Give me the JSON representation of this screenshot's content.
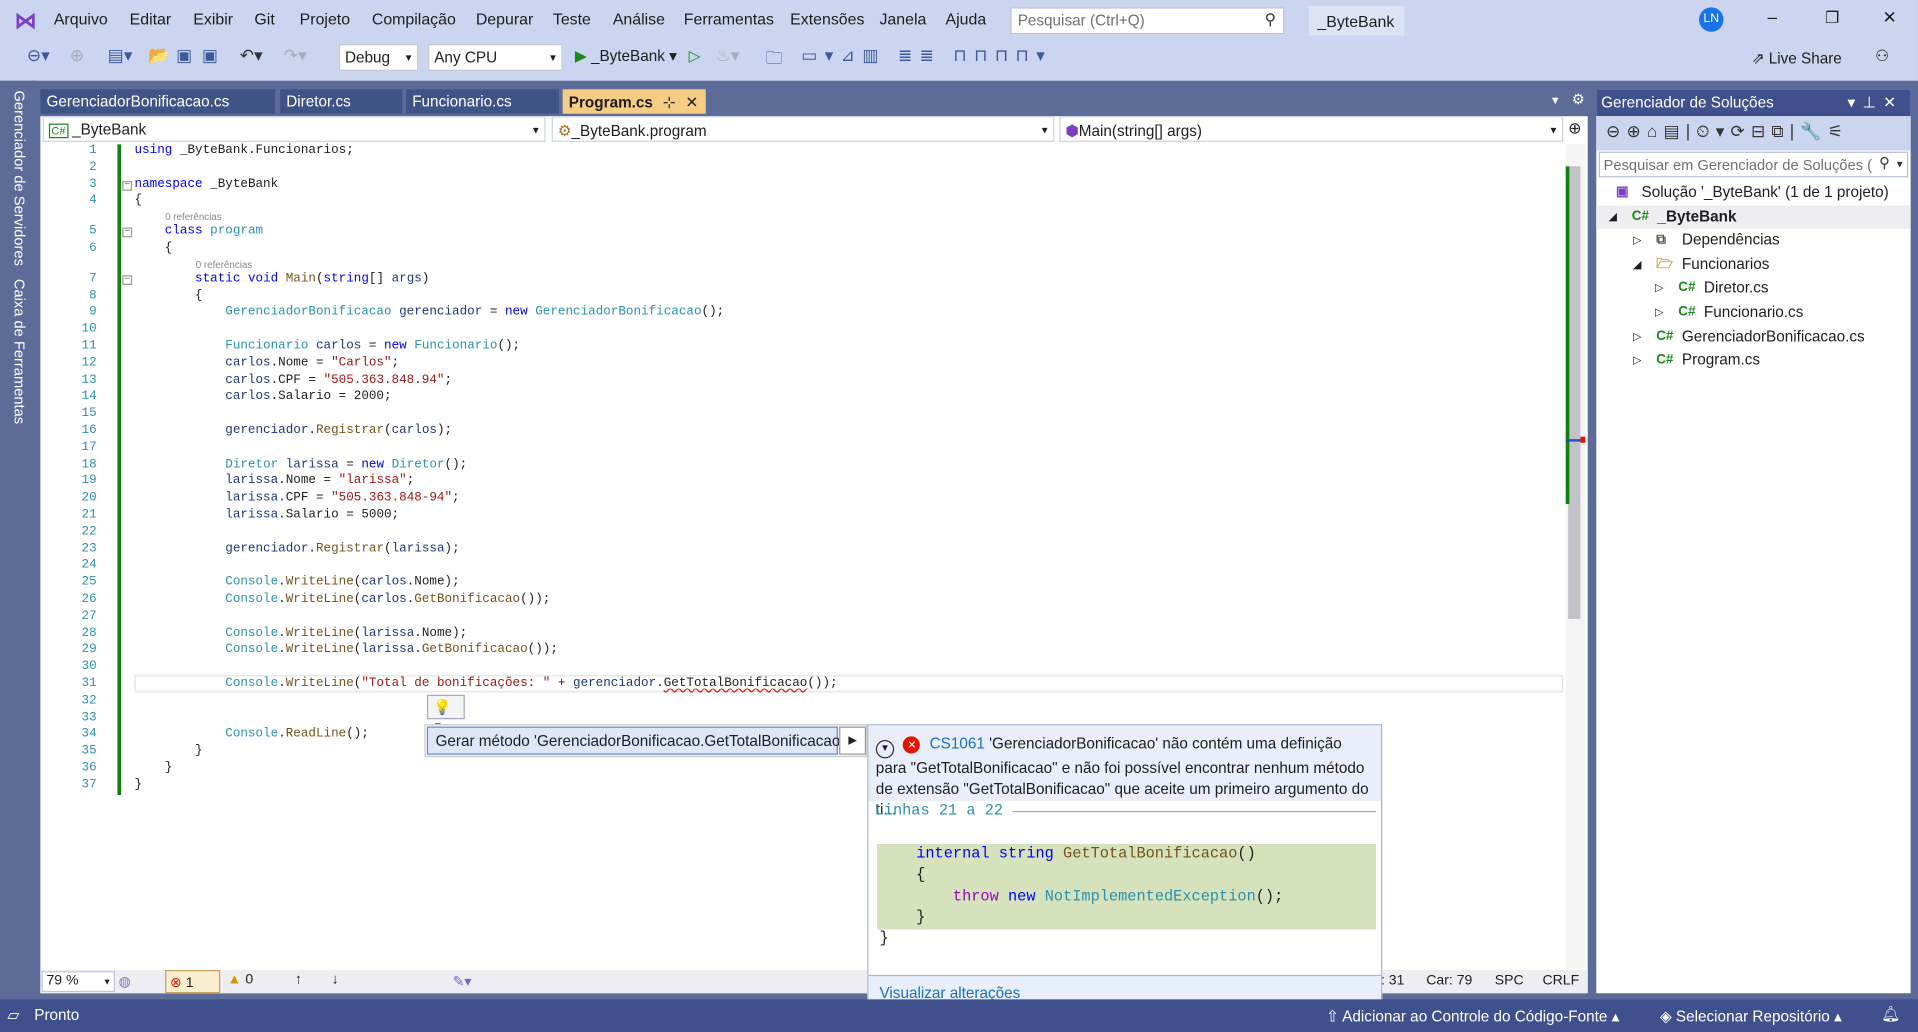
{
  "menu": [
    "Arquivo",
    "Editar",
    "Exibir",
    "Git",
    "Projeto",
    "Compilação",
    "Depurar",
    "Teste",
    "Análise",
    "Ferramentas",
    "Extensões",
    "Janela",
    "Ajuda"
  ],
  "search_placeholder": "Pesquisar (Ctrl+Q)",
  "project_name": "_ByteBank",
  "avatar": "LN",
  "toolbar": {
    "config": "Debug",
    "platform": "Any CPU",
    "run": "_ByteBank",
    "live_share": "Live Share"
  },
  "left_strip": [
    "Gerenciador de Servidores",
    "Caixa de Ferramentas"
  ],
  "tabs": [
    {
      "label": "GerenciadorBonificacao.cs"
    },
    {
      "label": "Diretor.cs"
    },
    {
      "label": "Funcionario.cs"
    },
    {
      "label": "Program.cs",
      "active": true
    }
  ],
  "nav": {
    "project": "_ByteBank",
    "class": "_ByteBank.program",
    "member": "Main(string[] args)"
  },
  "codelens": "0 referências",
  "code": [
    [
      1,
      [
        [
          "using",
          "kw"
        ],
        [
          " _ByteBank.Funcionarios;",
          ""
        ]
      ]
    ],
    [
      2,
      []
    ],
    [
      3,
      [
        [
          "namespace",
          "kw"
        ],
        [
          " _ByteBank",
          ""
        ]
      ]
    ],
    [
      4,
      [
        [
          "{",
          ""
        ]
      ]
    ],
    [
      5,
      [
        [
          "    ",
          ""
        ],
        [
          "class",
          "kw"
        ],
        [
          " ",
          ""
        ],
        [
          "program",
          "ty"
        ]
      ],
      "lens"
    ],
    [
      6,
      [
        [
          "    {",
          ""
        ]
      ]
    ],
    [
      7,
      [
        [
          "        ",
          ""
        ],
        [
          "static",
          "kw"
        ],
        [
          " ",
          ""
        ],
        [
          "void",
          "kw"
        ],
        [
          " ",
          ""
        ],
        [
          "Main",
          "me"
        ],
        [
          "(",
          ""
        ],
        [
          "string",
          "kw"
        ],
        [
          "[] ",
          ""
        ],
        [
          "args",
          "va"
        ],
        [
          ")",
          ""
        ]
      ],
      "lens"
    ],
    [
      8,
      [
        [
          "        {",
          ""
        ]
      ]
    ],
    [
      9,
      [
        [
          "            ",
          ""
        ],
        [
          "GerenciadorBonificacao",
          "ty"
        ],
        [
          " ",
          ""
        ],
        [
          "gerenciador",
          "va"
        ],
        [
          " = ",
          ""
        ],
        [
          "new",
          "kw"
        ],
        [
          " ",
          ""
        ],
        [
          "GerenciadorBonificacao",
          "ty"
        ],
        [
          "();",
          ""
        ]
      ]
    ],
    [
      10,
      []
    ],
    [
      11,
      [
        [
          "            ",
          ""
        ],
        [
          "Funcionario",
          "ty"
        ],
        [
          " ",
          ""
        ],
        [
          "carlos",
          "va"
        ],
        [
          " = ",
          ""
        ],
        [
          "new",
          "kw"
        ],
        [
          " ",
          ""
        ],
        [
          "Funcionario",
          "ty"
        ],
        [
          "();",
          ""
        ]
      ]
    ],
    [
      12,
      [
        [
          "            ",
          ""
        ],
        [
          "carlos",
          "va"
        ],
        [
          ".Nome = ",
          ""
        ],
        [
          "\"Carlos\"",
          "st"
        ],
        [
          ";",
          ""
        ]
      ]
    ],
    [
      13,
      [
        [
          "            ",
          ""
        ],
        [
          "carlos",
          "va"
        ],
        [
          ".CPF = ",
          ""
        ],
        [
          "\"505.363.848.94\"",
          "st"
        ],
        [
          ";",
          ""
        ]
      ]
    ],
    [
      14,
      [
        [
          "            ",
          ""
        ],
        [
          "carlos",
          "va"
        ],
        [
          ".Salario = 2000;",
          ""
        ]
      ]
    ],
    [
      15,
      []
    ],
    [
      16,
      [
        [
          "            ",
          ""
        ],
        [
          "gerenciador",
          "va"
        ],
        [
          ".",
          ""
        ],
        [
          "Registrar",
          "me"
        ],
        [
          "(",
          ""
        ],
        [
          "carlos",
          "va"
        ],
        [
          ");",
          ""
        ]
      ]
    ],
    [
      17,
      []
    ],
    [
      18,
      [
        [
          "            ",
          ""
        ],
        [
          "Diretor",
          "ty"
        ],
        [
          " ",
          ""
        ],
        [
          "larissa",
          "va"
        ],
        [
          " = ",
          ""
        ],
        [
          "new",
          "kw"
        ],
        [
          " ",
          ""
        ],
        [
          "Diretor",
          "ty"
        ],
        [
          "();",
          ""
        ]
      ]
    ],
    [
      19,
      [
        [
          "            ",
          ""
        ],
        [
          "larissa",
          "va"
        ],
        [
          ".Nome = ",
          ""
        ],
        [
          "\"larissa\"",
          "st"
        ],
        [
          ";",
          ""
        ]
      ]
    ],
    [
      20,
      [
        [
          "            ",
          ""
        ],
        [
          "larissa",
          "va"
        ],
        [
          ".CPF = ",
          ""
        ],
        [
          "\"505.363.848-94\"",
          "st"
        ],
        [
          ";",
          ""
        ]
      ]
    ],
    [
      21,
      [
        [
          "            ",
          ""
        ],
        [
          "larissa",
          "va"
        ],
        [
          ".Salario = 5000;",
          ""
        ]
      ]
    ],
    [
      22,
      []
    ],
    [
      23,
      [
        [
          "            ",
          ""
        ],
        [
          "gerenciador",
          "va"
        ],
        [
          ".",
          ""
        ],
        [
          "Registrar",
          "me"
        ],
        [
          "(",
          ""
        ],
        [
          "larissa",
          "va"
        ],
        [
          ");",
          ""
        ]
      ]
    ],
    [
      24,
      []
    ],
    [
      25,
      [
        [
          "            ",
          ""
        ],
        [
          "Console",
          "ty"
        ],
        [
          ".",
          ""
        ],
        [
          "WriteLine",
          "me"
        ],
        [
          "(",
          ""
        ],
        [
          "carlos",
          "va"
        ],
        [
          ".Nome);",
          ""
        ]
      ]
    ],
    [
      26,
      [
        [
          "            ",
          ""
        ],
        [
          "Console",
          "ty"
        ],
        [
          ".",
          ""
        ],
        [
          "WriteLine",
          "me"
        ],
        [
          "(",
          ""
        ],
        [
          "carlos",
          "va"
        ],
        [
          ".",
          ""
        ],
        [
          "GetBonificacao",
          "me"
        ],
        [
          "());",
          ""
        ]
      ]
    ],
    [
      27,
      []
    ],
    [
      28,
      [
        [
          "            ",
          ""
        ],
        [
          "Console",
          "ty"
        ],
        [
          ".",
          ""
        ],
        [
          "WriteLine",
          "me"
        ],
        [
          "(",
          ""
        ],
        [
          "larissa",
          "va"
        ],
        [
          ".Nome);",
          ""
        ]
      ]
    ],
    [
      29,
      [
        [
          "            ",
          ""
        ],
        [
          "Console",
          "ty"
        ],
        [
          ".",
          ""
        ],
        [
          "WriteLine",
          "me"
        ],
        [
          "(",
          ""
        ],
        [
          "larissa",
          "va"
        ],
        [
          ".",
          ""
        ],
        [
          "GetBonificacao",
          "me"
        ],
        [
          "());",
          ""
        ]
      ]
    ],
    [
      30,
      []
    ],
    [
      31,
      [
        [
          "            ",
          ""
        ],
        [
          "Console",
          "ty"
        ],
        [
          ".",
          ""
        ],
        [
          "WriteLine",
          "me"
        ],
        [
          "(",
          ""
        ],
        [
          "\"Total de bonificações: \"",
          "st"
        ],
        [
          " + ",
          ""
        ],
        [
          "gerenciador",
          "va"
        ],
        [
          ".",
          ""
        ],
        [
          "GetTotalBonificacao",
          "err"
        ],
        [
          "());",
          ""
        ]
      ]
    ],
    [
      32,
      []
    ],
    [
      33,
      []
    ],
    [
      34,
      [
        [
          "            ",
          ""
        ],
        [
          "Console",
          "ty"
        ],
        [
          ".",
          ""
        ],
        [
          "ReadLine",
          "me"
        ],
        [
          "();",
          ""
        ]
      ]
    ],
    [
      35,
      [
        [
          "        }",
          ""
        ]
      ]
    ],
    [
      36,
      [
        [
          "    }",
          ""
        ]
      ]
    ],
    [
      37,
      [
        [
          "}",
          ""
        ]
      ]
    ]
  ],
  "quick_action": "Gerar método 'GerenciadorBonificacao.GetTotalBonificacao'",
  "preview": {
    "code": "CS1061",
    "message": "'GerenciadorBonificacao' não contém uma definição para \"GetTotalBonificacao\" e não foi possível encontrar nenhum método de extensão \"GetTotalBonificacao\" que aceite um primeiro argumento do ti...",
    "lines": "Linhas 21 a 22",
    "view_changes": "Visualizar alterações"
  },
  "editor_status": {
    "zoom": "79 %",
    "errors": "1",
    "warnings": "0",
    "line": ": 31",
    "col": "Car: 79",
    "spc": "SPC",
    "crlf": "CRLF"
  },
  "solution": {
    "title": "Gerenciador de Soluções",
    "search_placeholder": "Pesquisar em Gerenciador de Soluções (",
    "items": [
      {
        "label": "Solução '_ByteBank' (1 de 1 projeto)",
        "icon": "solution-icon"
      },
      {
        "label": "_ByteBank",
        "icon": "csproj-icon"
      },
      {
        "label": "Dependências",
        "icon": "dependencies-icon"
      },
      {
        "label": "Funcionarios",
        "icon": "folder-icon"
      },
      {
        "label": "Diretor.cs",
        "icon": "csharp-file-icon"
      },
      {
        "label": "Funcionario.cs",
        "icon": "csharp-file-icon"
      },
      {
        "label": "GerenciadorBonificacao.cs",
        "icon": "csharp-file-icon"
      },
      {
        "label": "Program.cs",
        "icon": "csharp-file-icon"
      }
    ]
  },
  "statusbar": {
    "ready": "Pronto",
    "source_control": "Adicionar ao Controle do Código-Fonte",
    "repo": "Selecionar Repositório"
  }
}
